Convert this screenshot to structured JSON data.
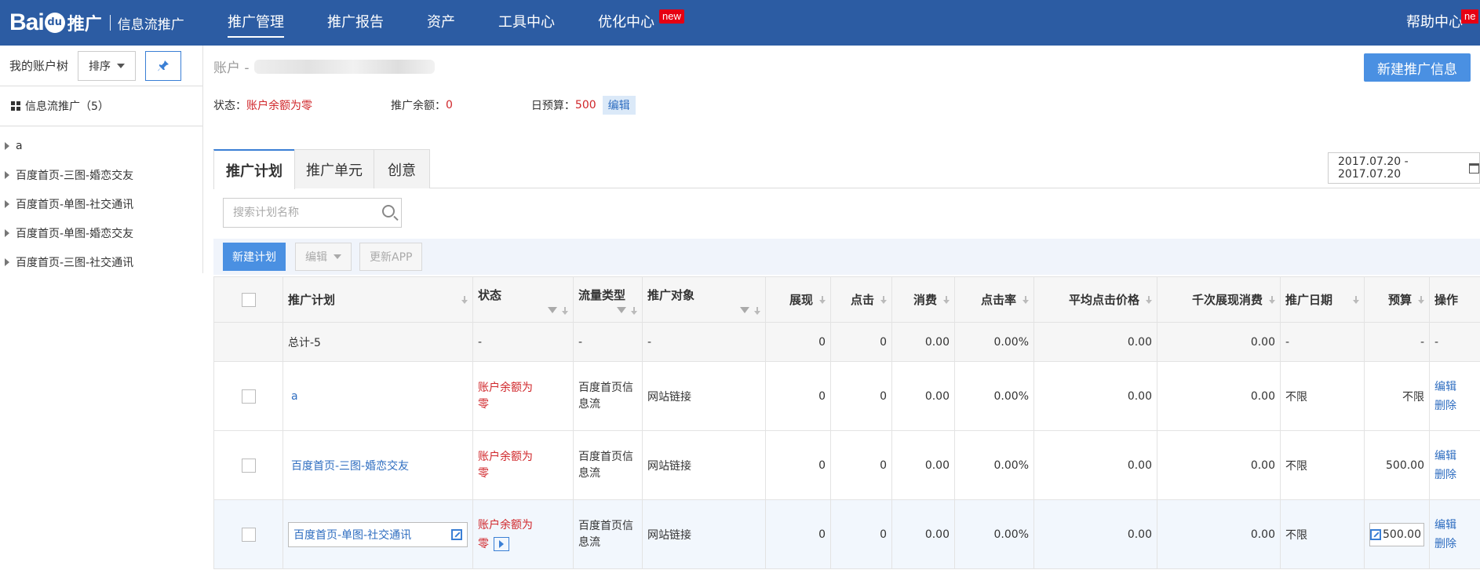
{
  "header": {
    "logo_text": "Bai",
    "logo_paw": "du",
    "logo_suffix": "推广",
    "product": "信息流推广",
    "nav": [
      "推广管理",
      "推广报告",
      "资产",
      "工具中心",
      "优化中心"
    ],
    "nav_badge": "new",
    "help": "帮助中心",
    "help_badge": "ne"
  },
  "sidebar": {
    "title": "我的账户树",
    "sort_label": "排序",
    "root_label": "信息流推广（5）",
    "items": [
      "a",
      "百度首页-三图-婚恋交友",
      "百度首页-单图-社交通讯",
      "百度首页-单图-婚恋交友",
      "百度首页-三图-社交通讯"
    ]
  },
  "account": {
    "label": "账户 -",
    "status_label": "状态：",
    "status_value": "账户余额为零",
    "balance_label": "推广余额：",
    "balance_value": "0",
    "budget_label": "日预算：",
    "budget_value": "500",
    "edit": "编辑",
    "new_promo": "新建推广信息"
  },
  "tabs": [
    "推广计划",
    "推广单元",
    "创意"
  ],
  "date_range": "2017.07.20 - 2017.07.20",
  "search_placeholder": "搜索计划名称",
  "toolbar": {
    "new_plan": "新建计划",
    "edit": "编辑",
    "update_app": "更新APP"
  },
  "table": {
    "headers": [
      "推广计划",
      "状态",
      "流量类型",
      "推广对象",
      "展现",
      "点击",
      "消费",
      "点击率",
      "平均点击价格",
      "千次展现消费",
      "推广日期",
      "预算",
      "操作"
    ],
    "total": [
      "总计-5",
      "-",
      "-",
      "-",
      "0",
      "0",
      "0.00",
      "0.00%",
      "0.00",
      "0.00",
      "-",
      "-",
      "-"
    ],
    "rows": [
      {
        "name": "a",
        "status_a": "账户余额为",
        "status_b": "零",
        "traffic_a": "百度首页信",
        "traffic_b": "息流",
        "target": "网站链接",
        "impr": "0",
        "clicks": "0",
        "cost": "0.00",
        "ctr": "0.00%",
        "cpc": "0.00",
        "cpm": "0.00",
        "date": "不限",
        "budget": "不限",
        "op_edit": "编辑",
        "op_del": "删除"
      },
      {
        "name": "百度首页-三图-婚恋交友",
        "status_a": "账户余额为",
        "status_b": "零",
        "traffic_a": "百度首页信",
        "traffic_b": "息流",
        "target": "网站链接",
        "impr": "0",
        "clicks": "0",
        "cost": "0.00",
        "ctr": "0.00%",
        "cpc": "0.00",
        "cpm": "0.00",
        "date": "不限",
        "budget": "500.00",
        "op_edit": "编辑",
        "op_del": "删除"
      },
      {
        "name": "百度首页-单图-社交通讯",
        "status_a": "账户余额为",
        "status_b": "零",
        "traffic_a": "百度首页信",
        "traffic_b": "息流",
        "target": "网站链接",
        "impr": "0",
        "clicks": "0",
        "cost": "0.00",
        "ctr": "0.00%",
        "cpc": "0.00",
        "cpm": "0.00",
        "date": "不限",
        "budget": "500.00",
        "op_edit": "编辑",
        "op_del": "删除"
      }
    ]
  },
  "colors": {
    "header_bg": "#2c5ca3",
    "primary": "#4a90e2",
    "alert": "#d0262a",
    "link": "#2e6dc0"
  }
}
